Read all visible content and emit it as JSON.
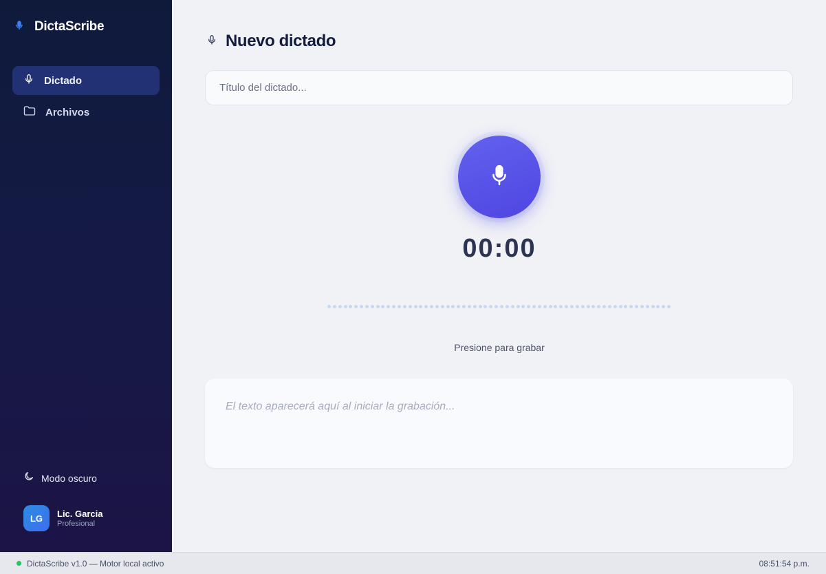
{
  "brand": {
    "name": "DictaScribe",
    "icon": "mic-icon",
    "icon_color": "#3b82f6"
  },
  "sidebar": {
    "items": [
      {
        "label": "Dictado",
        "icon": "mic-icon",
        "active": true
      },
      {
        "label": "Archivos",
        "icon": "folder-icon",
        "active": false
      }
    ],
    "dark_mode_label": "Modo oscuro",
    "user": {
      "initials": "LG",
      "name": "Lic. Garcia",
      "role": "Profesional"
    }
  },
  "main": {
    "title": "Nuevo dictado",
    "title_placeholder": "Título del dictado...",
    "timer": "00:00",
    "hint": "Presione para grabar",
    "transcript_placeholder": "El texto aparecerá aquí al iniciar la grabación..."
  },
  "statusbar": {
    "text": "DictaScribe v1.0 — Motor local activo",
    "status_color": "#22c55e",
    "clock": "08:51:54 p.m."
  },
  "colors": {
    "accent": "#5b55ea",
    "sidebar_top": "#0f1a3b",
    "sidebar_bottom": "#1c1446",
    "active_item": "#223173"
  }
}
